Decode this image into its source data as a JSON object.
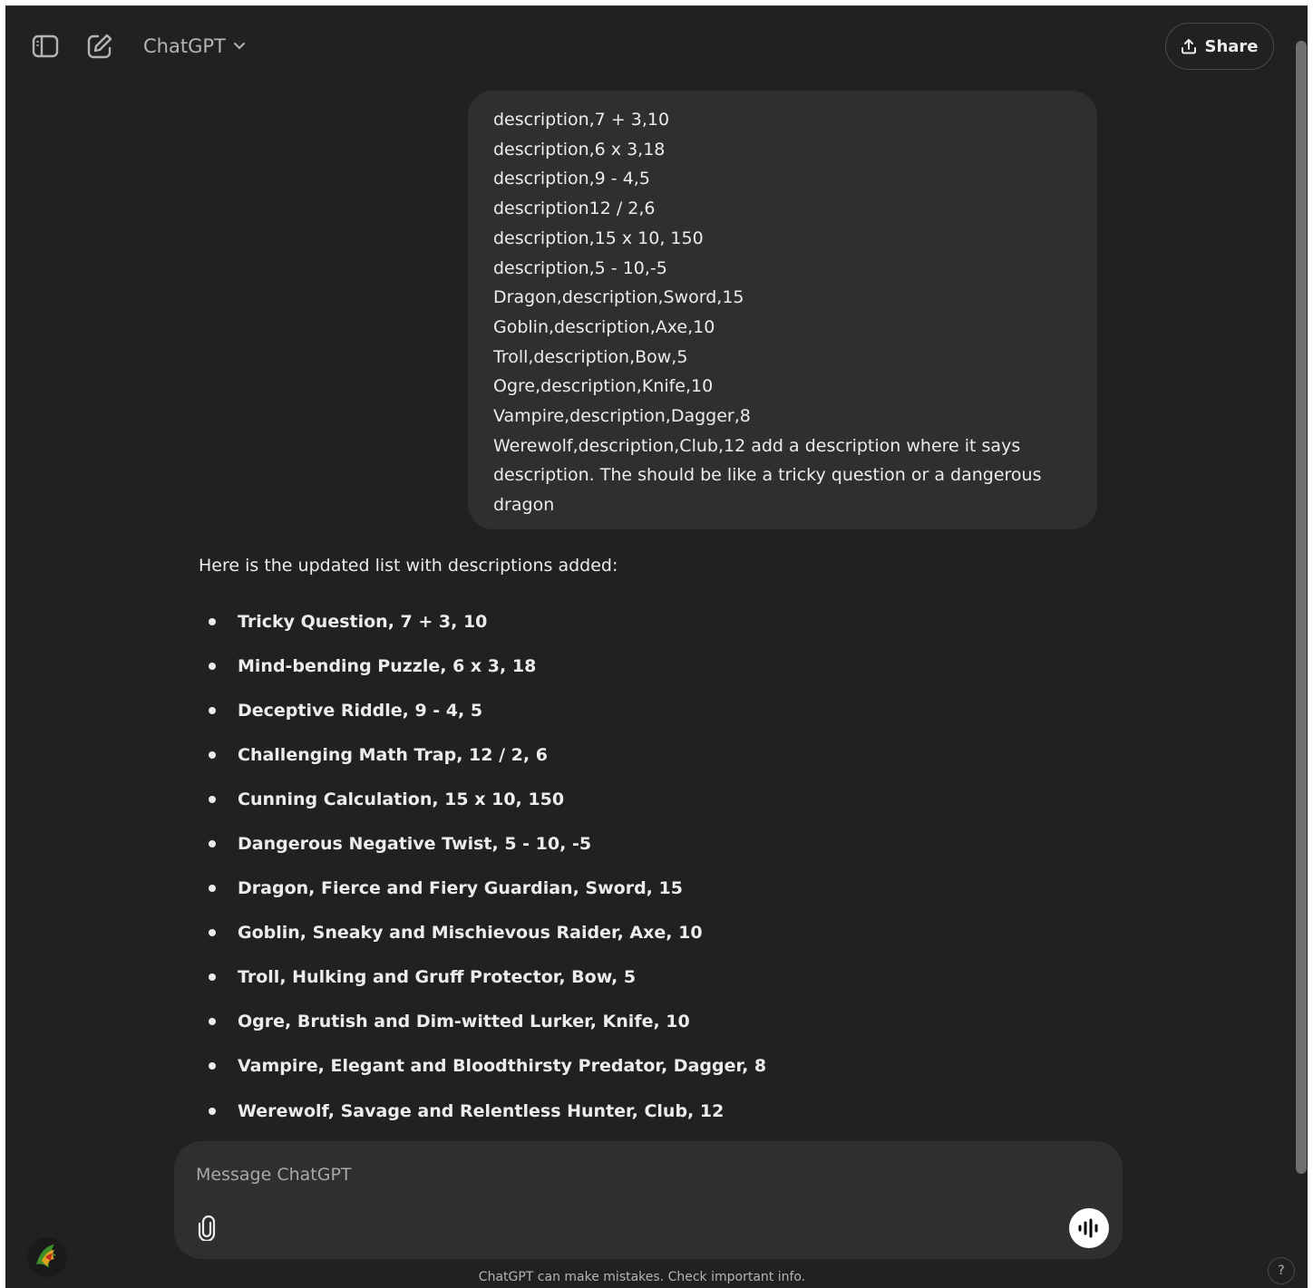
{
  "header": {
    "model_name": "ChatGPT",
    "share_label": "Share"
  },
  "icons": {
    "sidebar": "sidebar-toggle-icon",
    "new_chat": "pencil-square-icon",
    "chevron": "chevron-down-icon",
    "share": "upload-icon",
    "attach": "paperclip-icon",
    "voice": "waveform-icon",
    "help": "question-icon"
  },
  "user_message": {
    "lines": [
      "description,7 + 3,10",
      "description,6 x 3,18",
      "description,9 - 4,5",
      "description12 / 2,6",
      "description,15 x 10, 150",
      "description,5 - 10,-5",
      "Dragon,description,Sword,15",
      "Goblin,description,Axe,10",
      "Troll,description,Bow,5",
      "Ogre,description,Knife,10",
      "Vampire,description,Dagger,8",
      "Werewolf,description,Club,12 add a description where it says description. The should be like a tricky question or a dangerous dragon"
    ]
  },
  "assistant_message": {
    "intro": "Here is the updated list with descriptions added:",
    "items": [
      "Tricky Question, 7 + 3, 10",
      "Mind-bending Puzzle, 6 x 3, 18",
      "Deceptive Riddle, 9 - 4, 5",
      "Challenging Math Trap, 12 / 2, 6",
      "Cunning Calculation, 15 x 10, 150",
      "Dangerous Negative Twist, 5 - 10, -5",
      "Dragon, Fierce and Fiery Guardian, Sword, 15",
      "Goblin, Sneaky and Mischievous Raider, Axe, 10",
      "Troll, Hulking and Gruff Protector, Bow, 5",
      "Ogre, Brutish and Dim-witted Lurker, Knife, 10",
      "Vampire, Elegant and Bloodthirsty Predator, Dagger, 8",
      "Werewolf, Savage and Relentless Hunter, Club, 12"
    ]
  },
  "composer": {
    "placeholder": "Message ChatGPT"
  },
  "footer": {
    "disclaimer": "ChatGPT can make mistakes. Check important info.",
    "help_label": "?"
  }
}
